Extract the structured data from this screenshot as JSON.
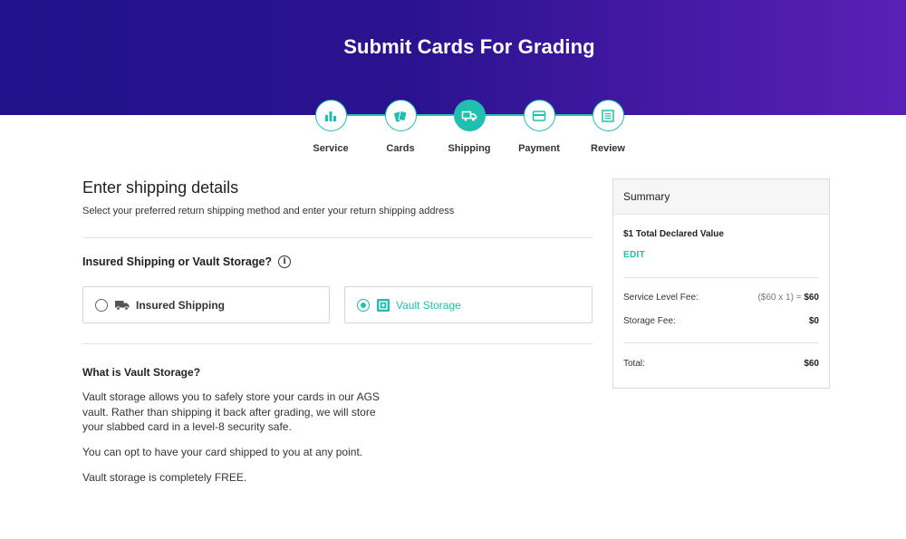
{
  "header": {
    "title": "Submit Cards For Grading"
  },
  "steps": [
    {
      "label": "Service",
      "icon": "bar-chart-icon",
      "state": "complete"
    },
    {
      "label": "Cards",
      "icon": "cards-icon",
      "state": "complete"
    },
    {
      "label": "Shipping",
      "icon": "truck-icon",
      "state": "active"
    },
    {
      "label": "Payment",
      "icon": "credit-card-icon",
      "state": "upcoming"
    },
    {
      "label": "Review",
      "icon": "review-list-icon",
      "state": "upcoming"
    }
  ],
  "main": {
    "heading": "Enter shipping details",
    "subheading": "Select your preferred return shipping method and enter your return shipping address",
    "question": "Insured Shipping or Vault Storage?",
    "options": [
      {
        "label": "Insured Shipping",
        "icon": "truck-icon",
        "selected": false
      },
      {
        "label": "Vault Storage",
        "icon": "vault-icon",
        "selected": true
      }
    ],
    "vault_title": "What is Vault Storage?",
    "vault_paragraphs": [
      "Vault storage allows you to safely store your cards in our AGS vault. Rather than shipping it back after grading, we will store your slabbed card in a level-8 security safe.",
      "You can opt to have your card shipped to you at any point.",
      "Vault storage is completely FREE."
    ]
  },
  "summary": {
    "title": "Summary",
    "declared_value": "$1 Total Declared Value",
    "edit_label": "EDIT",
    "service_fee_label": "Service Level Fee:",
    "service_fee_calc": "($60  x 1) = ",
    "service_fee_value": "$60",
    "storage_fee_label": "Storage Fee:",
    "storage_fee_value": "$0",
    "total_label": "Total:",
    "total_value": "$60"
  },
  "colors": {
    "accent": "#20bfb0",
    "header_start": "#22118a",
    "header_end": "#5a20b5"
  }
}
